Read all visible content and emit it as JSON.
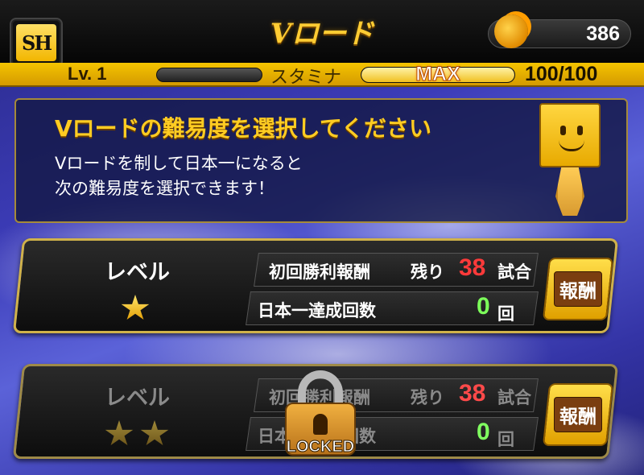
{
  "header": {
    "logo_text": "SH",
    "title": "Vロード",
    "coins": "386"
  },
  "status": {
    "level": "Lv. 1",
    "stamina_label": "スタミナ",
    "stamina_state": "MAX",
    "stamina_value": "100/100",
    "stamina_fraction": 1.0
  },
  "message": {
    "heading": "Vロードの難易度を選択してください",
    "line1": "Vロードを制して日本一になると",
    "line2": "次の難易度を選択できます！"
  },
  "levels": [
    {
      "label": "レベル",
      "stars": 1,
      "first_win_label": "初回勝利報酬",
      "remaining_label": "残り",
      "remaining_games": "38",
      "games_unit": "試合",
      "champion_label": "日本一達成回数",
      "champion_count": "0",
      "count_unit": "回",
      "reward_button": "報酬",
      "locked": false
    },
    {
      "label": "レベル",
      "stars": 2,
      "first_win_label": "初回勝利報酬",
      "remaining_label": "残り",
      "remaining_games": "38",
      "games_unit": "試合",
      "champion_label": "日本一達成回数",
      "champion_count": "0",
      "count_unit": "回",
      "reward_button": "報酬",
      "locked": true,
      "lock_text": "LOCKED"
    }
  ],
  "colors": {
    "gold": "#ffcc22",
    "remaining_number": "#ff3a3a",
    "count_number": "#7cff5a"
  }
}
